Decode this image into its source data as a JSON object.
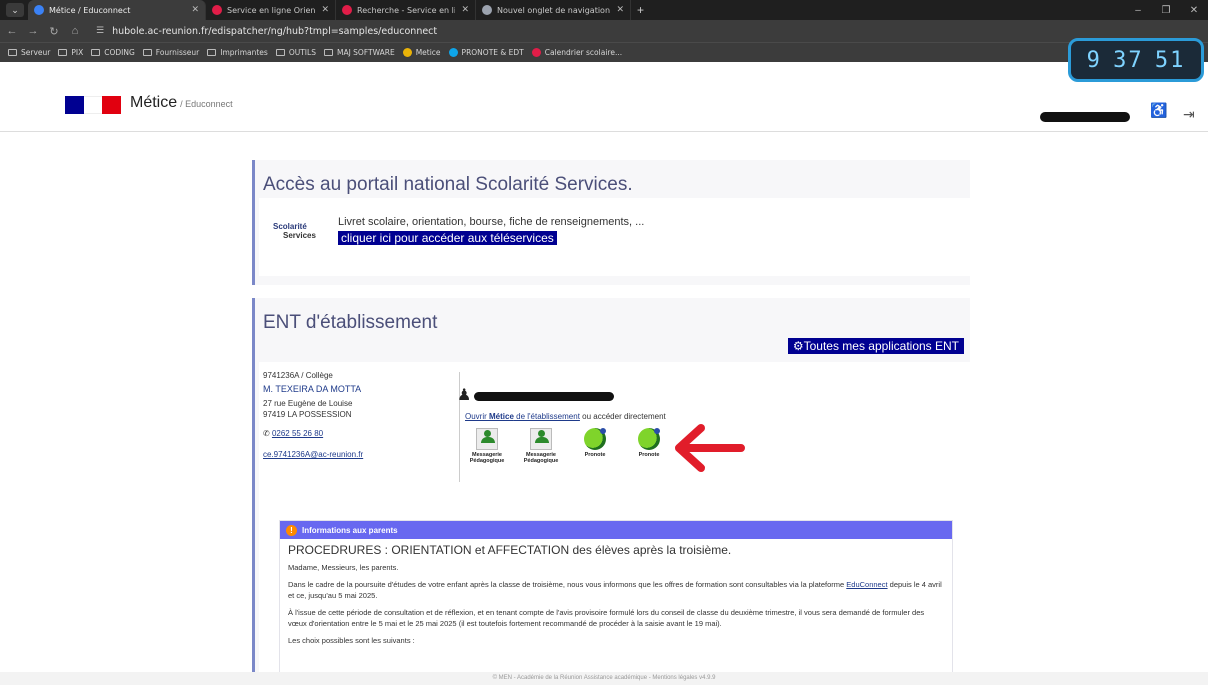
{
  "browser": {
    "tabs": [
      {
        "label": "Métice / Educonnect",
        "favicon": "globe-icon",
        "color": "#3b82f6"
      },
      {
        "label": "Service en ligne Orientation - I",
        "favicon": "marianne-icon",
        "color": "#e11d48"
      },
      {
        "label": "Recherche - Service en ligne",
        "favicon": "marianne-icon",
        "color": "#e11d48"
      },
      {
        "label": "Nouvel onglet de navigation p",
        "favicon": "incognito-icon",
        "color": "#9ca3af"
      }
    ],
    "new_tab": "+",
    "url": "hubole.ac-reunion.fr/edispatcher/ng/hub?tmpl=samples/educonnect",
    "bookmarks": [
      {
        "label": "Serveur",
        "type": "folder"
      },
      {
        "label": "PIX",
        "type": "folder"
      },
      {
        "label": "CODING",
        "type": "folder"
      },
      {
        "label": "Fournisseur",
        "type": "folder"
      },
      {
        "label": "Imprimantes",
        "type": "folder"
      },
      {
        "label": "OUTILS",
        "type": "folder"
      },
      {
        "label": "MAJ SOFTWARE",
        "type": "folder"
      },
      {
        "label": "Metice",
        "type": "site",
        "color": "#eab308"
      },
      {
        "label": "PRONOTE & EDT",
        "type": "site",
        "color": "#0ea5e9"
      },
      {
        "label": "Calendrier scolaire...",
        "type": "site",
        "color": "#e11d48"
      }
    ],
    "clock_digits": [
      "9",
      "37",
      "51"
    ]
  },
  "header": {
    "brand": "Métice",
    "brand_sub": "/ Educonnect",
    "flag_colors": [
      "#000091",
      "#ffffff",
      "#e1000f"
    ]
  },
  "scolarite": {
    "title": "Accès au portail national Scolarité Services.",
    "logo_line1": "Scolarité",
    "logo_line2": "Services",
    "description": "Livret scolaire, orientation, bourse, fiche de renseignements, ...",
    "link": "cliquer ici pour accéder aux téléservices"
  },
  "ent": {
    "title": "ENT d'établissement",
    "all_apps_button": "Toutes mes applications ENT",
    "school": {
      "code": "9741236A / Collège",
      "name": "M. TEXEIRA DA MOTTA",
      "address1": "27 rue Eugène de Louise",
      "address2": "97419 LA POSSESSION",
      "phone": "0262 55 26 80",
      "email": "ce.9741236A@ac-reunion.fr"
    },
    "open_prefix": "Ouvrir ",
    "open_link_strong": "Métice",
    "open_link_rest": " de l'établissement",
    "open_suffix": " ou accéder directement",
    "apps": [
      {
        "line1": "Messagerie",
        "line2": "Pédagogique",
        "icon": "mail-icon"
      },
      {
        "line1": "Messagerie",
        "line2": "Pédagogique",
        "icon": "mail-icon"
      },
      {
        "line1": "Pronote",
        "line2": "",
        "icon": "pronote-icon"
      },
      {
        "line1": "Pronote",
        "line2": "",
        "icon": "pronote-icon"
      }
    ],
    "arrow_color": "#e11d2a"
  },
  "info": {
    "header": "Informations aux parents",
    "headline": "PROCEDRURES : ORIENTATION et AFFECTATION des élèves après la troisième.",
    "greeting": "Madame, Messieurs, les parents.",
    "p1_before": "Dans le cadre de la poursuite d'études de votre enfant après la classe de troisième, nous vous informons que les offres de formation sont consultables via la plateforme ",
    "p1_link": "EduConnect",
    "p1_after": " depuis le 4 avril et ce, jusqu'au 5 mai 2025.",
    "p2": "À l'issue de cette période de consultation et de réflexion, et en tenant compte de l'avis provisoire formulé lors du conseil de classe du deuxième trimestre, il vous sera demandé de formuler des vœux d'orientation entre le 5 mai et le 25 mai 2025 (il est toutefois fortement recommandé de procéder à la saisie avant le 19 mai).",
    "p3": "Les choix possibles sont les suivants :"
  },
  "footer": "© MEN - Académie de la Réunion Assistance académique - Mentions légales v4.9.9"
}
